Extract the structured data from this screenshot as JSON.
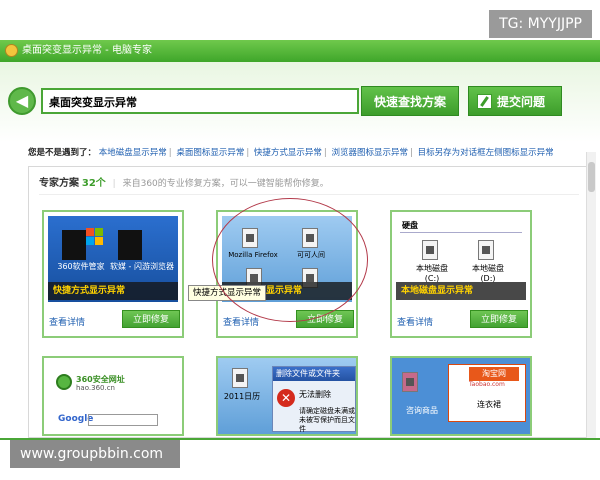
{
  "watermarks": {
    "top": "TG: MYYJJPP",
    "bottom": "www.groupbbin.com"
  },
  "window": {
    "title": "桌面突变显示异常 - 电脑专家"
  },
  "search": {
    "value": "桌面突变显示异常",
    "search_button": "快速查找方案",
    "ask_button": "提交问题"
  },
  "related": {
    "prompt": "您是不是遇到了：",
    "links": [
      "本地磁盘显示异常",
      "桌面图标显示异常",
      "快捷方式显示异常",
      "浏览器图标显示异常",
      "目标另存为对话框左侧图标显示异常"
    ]
  },
  "section": {
    "title": "专家方案",
    "count": "32个",
    "desc": "来自360的专业修复方案，可以一键智能帮你修复。"
  },
  "cards": [
    {
      "caption": "快捷方式显示异常",
      "detail": "查看详情",
      "fix": "立即修复",
      "icons": [
        "360软件管家",
        "软媒 - 闪游浏览器"
      ]
    },
    {
      "caption": "显示异常",
      "detail": "查看详情",
      "fix": "立即修复",
      "icons": [
        "Mozilla Firefox",
        "可可人间"
      ]
    },
    {
      "caption": "本地磁盘显示异常",
      "detail": "查看详情",
      "fix": "立即修复",
      "header": "硬盘",
      "icons": [
        "本地磁盘 (C:)",
        "本地磁盘 (D:)"
      ]
    }
  ],
  "tooltip": "快捷方式显示异常",
  "row2": {
    "c1": {
      "t1": "360安全网址",
      "t2": "hao.360.cn",
      "google": "Google"
    },
    "c2": {
      "title": "删除文件或文件夹",
      "msg1": "无法删除",
      "msg2": "请确定磁盘未满或未被写保护而且文件",
      "left_label": "2011日历"
    },
    "c3": {
      "brand": "淘宝网",
      "sub": "Taobao.com",
      "label": "连衣裙",
      "left_label": "咨询商品"
    }
  },
  "colors": {
    "accent": "#3fa62a",
    "link": "#1f5fb0",
    "caption": "#ffd200"
  }
}
